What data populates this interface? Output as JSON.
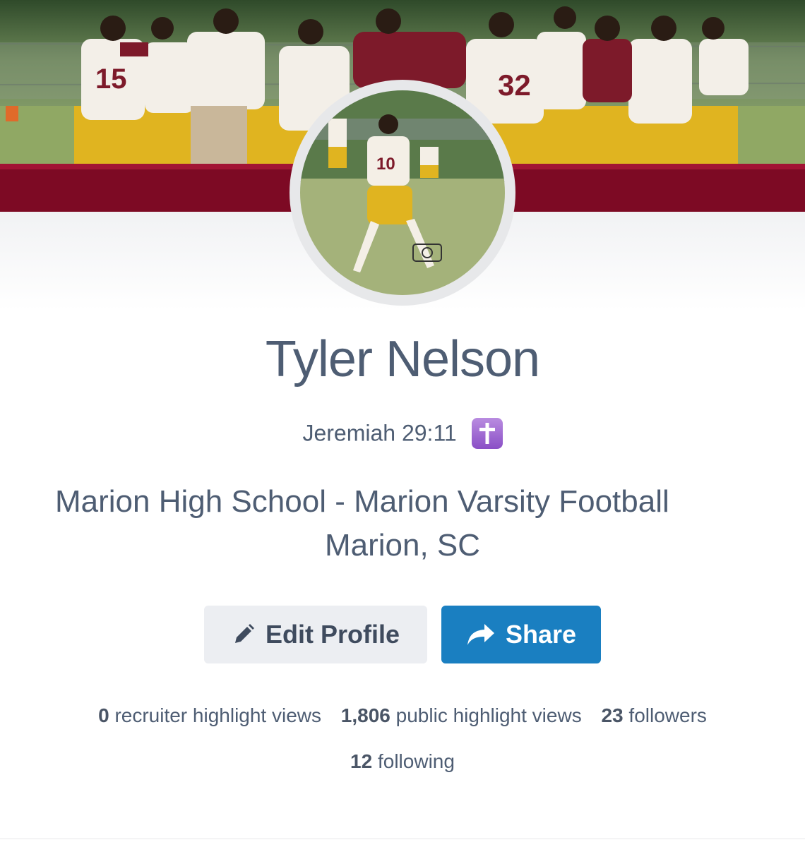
{
  "profile": {
    "name": "Tyler Nelson",
    "bio": "Jeremiah 29:11",
    "bio_emoji": "latin-cross-icon",
    "school": "Marion High School - Marion Varsity Football",
    "location": "Marion, SC"
  },
  "actions": {
    "edit_label": "Edit Profile",
    "edit_icon": "pencil-icon",
    "share_label": "Share",
    "share_icon": "share-arrow-icon"
  },
  "stats": {
    "recruiter_views_value": "0",
    "recruiter_views_label": "recruiter highlight views",
    "public_views_value": "1,806",
    "public_views_label": "public highlight views",
    "followers_value": "23",
    "followers_label": "followers",
    "following_value": "12",
    "following_label": "following"
  },
  "colors": {
    "brand_maroon": "#7d0a24",
    "share_blue": "#1a7fc1",
    "text_slate": "#4e5d73",
    "emoji_purple": "#9b64d2"
  }
}
